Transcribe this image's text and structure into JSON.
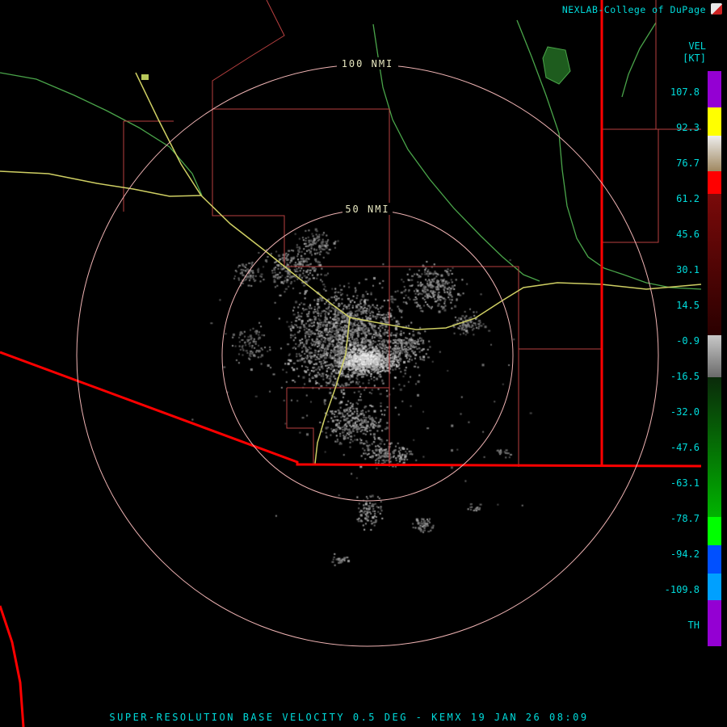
{
  "header": {
    "brand": "NEXLAB-College of DuPage"
  },
  "legend": {
    "title": "VEL",
    "units": "[KT]",
    "ticks": [
      "107.8",
      "92.3",
      "76.7",
      "61.2",
      "45.6",
      "30.1",
      "14.5",
      "-0.9",
      "-16.5",
      "-32.0",
      "-47.6",
      "-63.1",
      "-78.7",
      "-94.2",
      "-109.8"
    ],
    "threshold_label": "TH",
    "colorbar_segments": [
      {
        "h": 45,
        "c1": "#9400D3",
        "c2": "#9400D3"
      },
      {
        "h": 35,
        "c1": "#FFFF00",
        "c2": "#FFFF00"
      },
      {
        "h": 44,
        "c1": "#EDEDED",
        "c2": "#A08860"
      },
      {
        "h": 28,
        "c1": "#FF0000",
        "c2": "#FF0000"
      },
      {
        "h": 175,
        "c1": "#7A0A0A",
        "c2": "#2A0000"
      },
      {
        "h": 52,
        "c1": "#C8C8C8",
        "c2": "#6A6A6A"
      },
      {
        "h": 173,
        "c1": "#0A2A0A",
        "c2": "#00B400"
      },
      {
        "h": 35,
        "c1": "#00FF00",
        "c2": "#00FF00"
      },
      {
        "h": 35,
        "c1": "#0050FF",
        "c2": "#0050FF"
      },
      {
        "h": 33,
        "c1": "#00A0FF",
        "c2": "#00A0FF"
      },
      {
        "h": 57,
        "c1": "#9400D3",
        "c2": "#9400D3"
      }
    ]
  },
  "map": {
    "rings": [
      {
        "label": "100 NMI"
      },
      {
        "label": "50 NMI"
      }
    ],
    "colors": {
      "cyan": "#00DCDC",
      "ring": "#F0B4B4",
      "ring_label": "#E8E8C0",
      "county": "#B84040",
      "border": "#FF0000",
      "highway": "#CFCF63",
      "river": "#4AA54A"
    }
  },
  "footer": {
    "caption": "SUPER-RESOLUTION BASE VELOCITY 0.5 DEG - KEMX 19 JAN 26 08:09"
  }
}
